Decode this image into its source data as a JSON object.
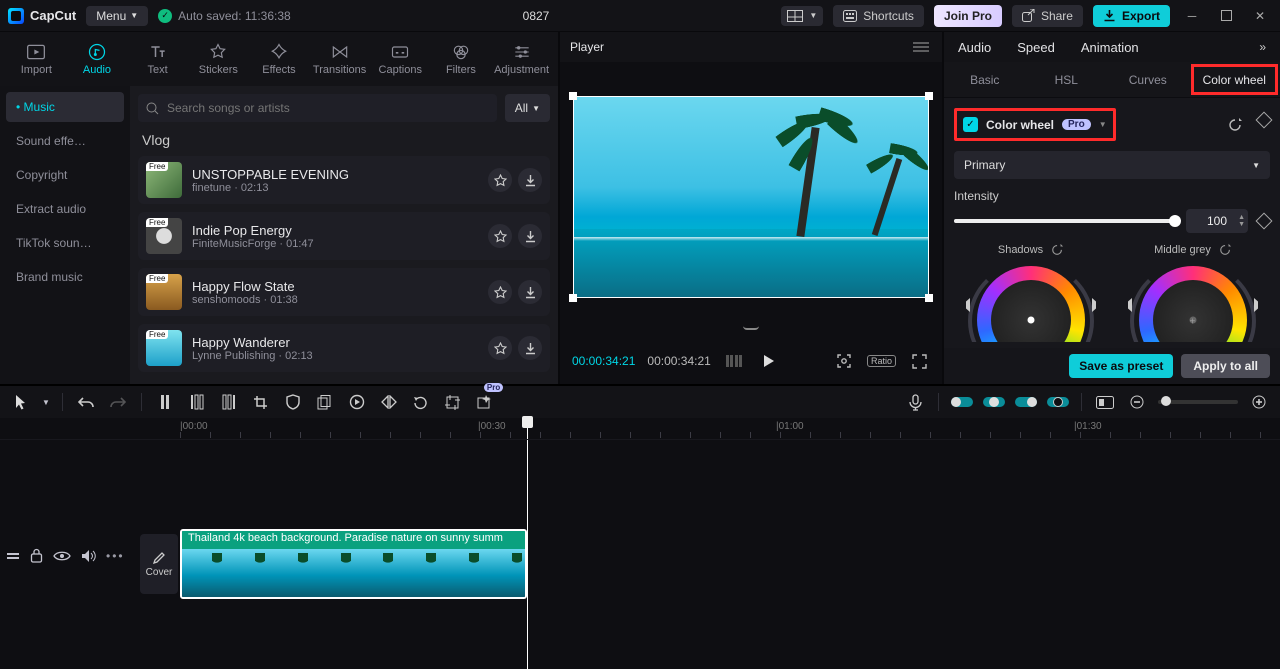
{
  "app": {
    "name": "CapCut",
    "menu": "Menu",
    "autosaved": "Auto saved: 11:36:38",
    "project": "0827"
  },
  "toolbar": {
    "shortcuts": "Shortcuts",
    "joinpro": "Join Pro",
    "share": "Share",
    "export": "Export"
  },
  "toolTabs": {
    "import": "Import",
    "audio": "Audio",
    "text": "Text",
    "stickers": "Stickers",
    "effects": "Effects",
    "transitions": "Transitions",
    "captions": "Captions",
    "filters": "Filters",
    "adjustment": "Adjustment"
  },
  "submenu": {
    "items": [
      "Music",
      "Sound effe…",
      "Copyright",
      "Extract audio",
      "TikTok soun…",
      "Brand music"
    ],
    "bullet": "•"
  },
  "search": {
    "placeholder": "Search songs or artists",
    "all": "All"
  },
  "category": "Vlog",
  "songs": [
    {
      "title": "UNSTOPPABLE EVENING",
      "artist": "finetune",
      "dur": "02:13",
      "free": "Free",
      "thumb": "plant"
    },
    {
      "title": "Indie Pop Energy",
      "artist": "FiniteMusicForge",
      "dur": "01:47",
      "free": "Free",
      "thumb": "disc"
    },
    {
      "title": "Happy Flow State",
      "artist": "senshomoods",
      "dur": "01:38",
      "free": "Free",
      "thumb": "field"
    },
    {
      "title": "Happy Wanderer",
      "artist": "Lynne Publishing",
      "dur": "02:13",
      "free": "Free",
      "thumb": "sky"
    }
  ],
  "player": {
    "title": "Player",
    "t_current": "00:00:34:21",
    "t_total": "00:00:34:21",
    "ratio": "Ratio"
  },
  "inspector": {
    "tabs": [
      "Audio",
      "Speed",
      "Animation"
    ],
    "subtabs": [
      "Basic",
      "HSL",
      "Curves",
      "Color wheel"
    ],
    "cw_label": "Color wheel",
    "pro": "Pro",
    "primary": "Primary",
    "intensity_label": "Intensity",
    "intensity_value": "100",
    "shadows": "Shadows",
    "middle_grey": "Middle grey",
    "save_preset": "Save as preset",
    "apply_all": "Apply to all"
  },
  "timelineRuler": [
    "|00:00",
    "|00:30",
    "|01:00",
    "|01:30"
  ],
  "coverBtn": "Cover",
  "clip": {
    "label": "Thailand 4k beach background. Paradise nature on sunny summ"
  }
}
